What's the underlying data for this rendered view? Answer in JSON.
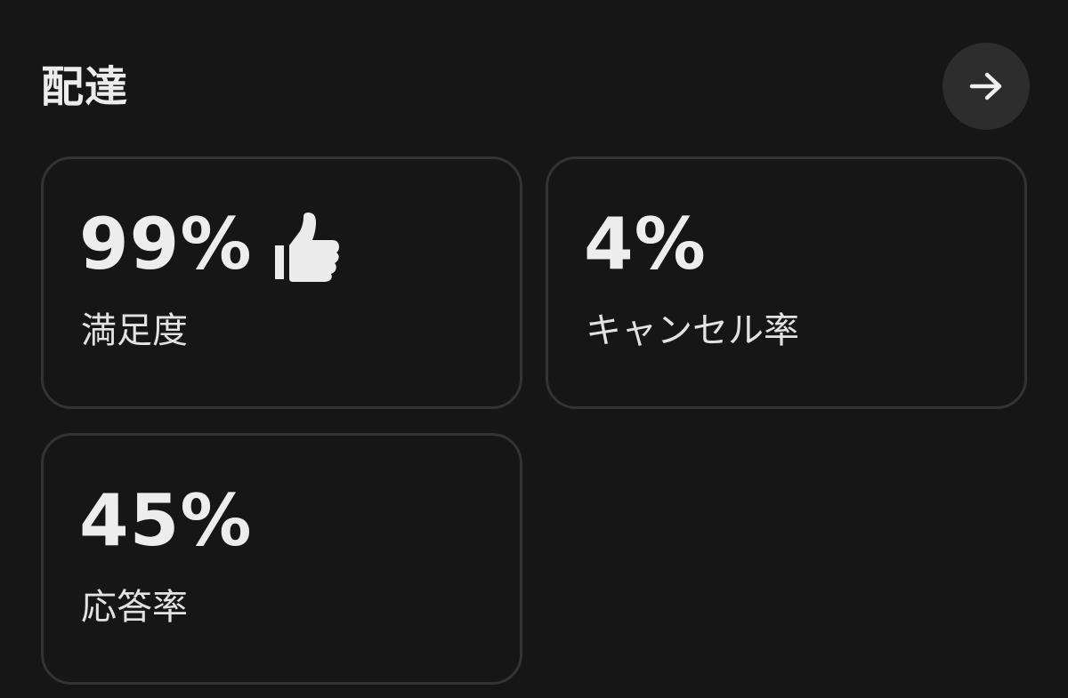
{
  "section": {
    "title": "配達"
  },
  "nav": {
    "arrow_icon": "arrow-right-icon"
  },
  "metrics": {
    "satisfaction": {
      "value": "99%",
      "label": "満足度",
      "icon": "thumbs-up-icon"
    },
    "cancellation": {
      "value": "4%",
      "label": "キャンセル率"
    },
    "response": {
      "value": "45%",
      "label": "応答率"
    }
  },
  "colors": {
    "background": "#161616",
    "card_border": "#333333",
    "button_bg": "#2d2d2d",
    "text": "#ececec"
  }
}
